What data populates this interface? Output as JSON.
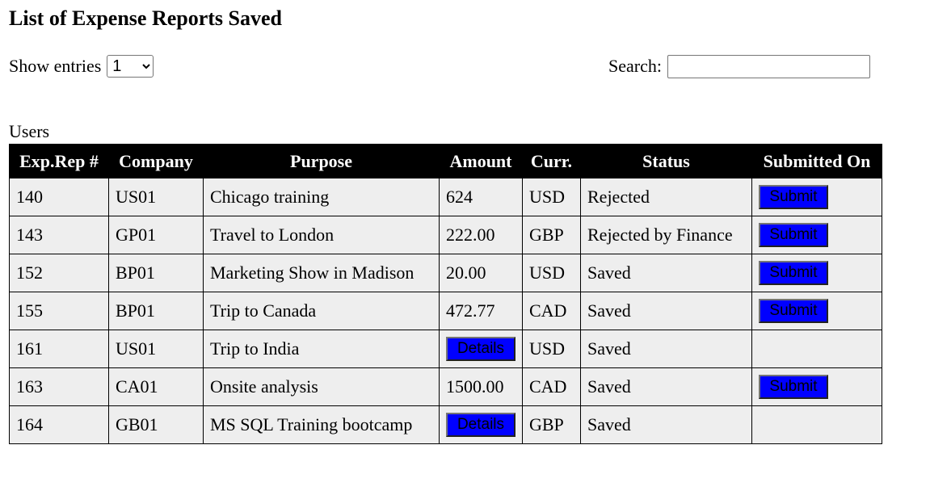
{
  "page": {
    "title": "List of Expense Reports Saved"
  },
  "controls": {
    "show_entries_label": "Show entries",
    "show_entries_value": "1",
    "search_label": "Search:",
    "search_value": ""
  },
  "table": {
    "caption": "Users",
    "headers": [
      "Exp.Rep #",
      "Company",
      "Purpose",
      "Amount",
      "Curr.",
      "Status",
      "Submitted On"
    ],
    "rows": [
      {
        "id": "140",
        "company": "US01",
        "purpose": "Chicago training",
        "amount": "624",
        "currency": "USD",
        "status": "Rejected",
        "submitted": "Submit"
      },
      {
        "id": "143",
        "company": "GP01",
        "purpose": "Travel to London",
        "amount": "222.00",
        "currency": "GBP",
        "status": "Rejected by Finance",
        "submitted": "Submit"
      },
      {
        "id": "152",
        "company": "BP01",
        "purpose": "Marketing Show in Madison",
        "amount": "20.00",
        "currency": "USD",
        "status": "Saved",
        "submitted": "Submit"
      },
      {
        "id": "155",
        "company": "BP01",
        "purpose": "Trip to Canada",
        "amount": "472.77",
        "currency": "CAD",
        "status": "Saved",
        "submitted": "Submit"
      },
      {
        "id": "161",
        "company": "US01",
        "purpose": "Trip to India",
        "amount": "Details",
        "amount_is_button": true,
        "currency": "USD",
        "status": "Saved",
        "submitted": ""
      },
      {
        "id": "163",
        "company": "CA01",
        "purpose": "Onsite analysis",
        "amount": "1500.00",
        "currency": "CAD",
        "status": "Saved",
        "submitted": "Submit"
      },
      {
        "id": "164",
        "company": "GB01",
        "purpose": "MS SQL Training bootcamp",
        "amount": "Details",
        "amount_is_button": true,
        "currency": "GBP",
        "status": "Saved",
        "submitted": ""
      }
    ]
  },
  "colors": {
    "header_bg": "#000000",
    "header_text": "#ffffff",
    "row_bg": "#eeeeee",
    "button_bg": "#0000ff"
  }
}
